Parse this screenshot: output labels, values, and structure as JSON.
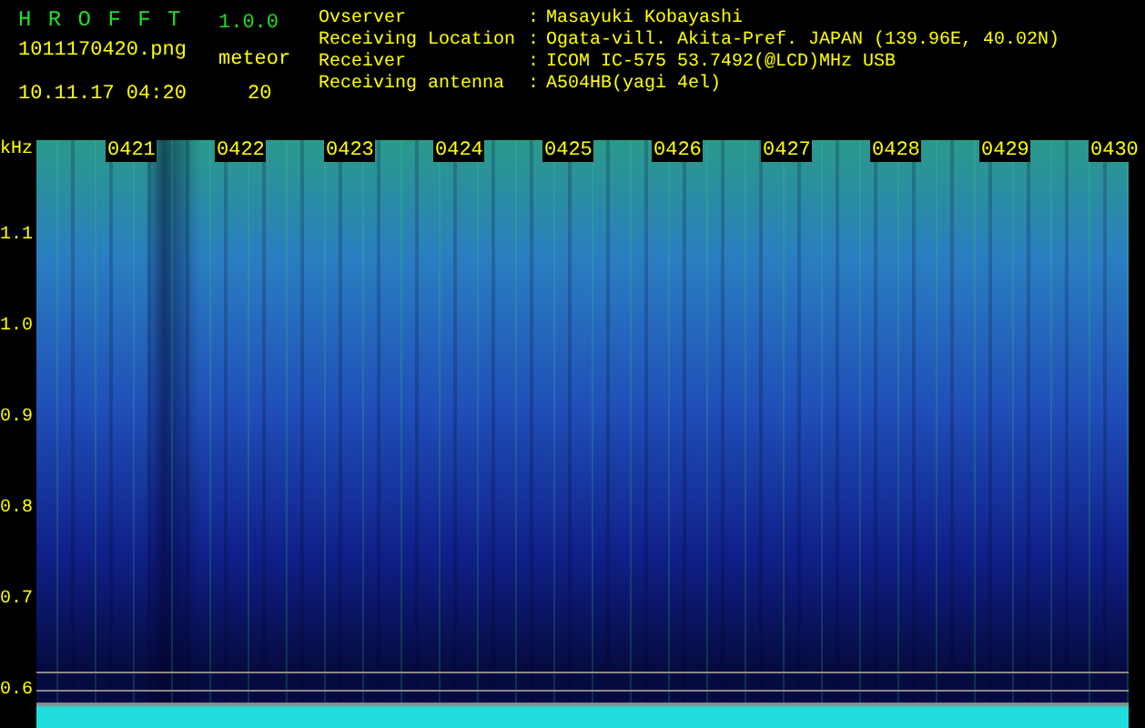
{
  "app": {
    "title": "H R O F F T",
    "version": "1.0.0",
    "file": "1011170420.png",
    "datetime": "10.11.17 04:20",
    "meteor_label": "meteor",
    "meteor_count": "20"
  },
  "info": [
    {
      "label": "Ovserver",
      "separator": ":",
      "value": "Masayuki Kobayashi"
    },
    {
      "label": "Receiving Location",
      "separator": ":",
      "value": "Ogata-vill. Akita-Pref. JAPAN (139.96E, 40.02N)"
    },
    {
      "label": "Receiver",
      "separator": ":",
      "value": "ICOM IC-575 53.7492(@LCD)MHz USB"
    },
    {
      "label": "Receiving antenna",
      "separator": ":",
      "value": "A504HB(yagi 4el)"
    }
  ],
  "spectrogram": {
    "unit": "kHz",
    "time_labels": [
      "0421",
      "0422",
      "0423",
      "0424",
      "0425",
      "0426",
      "0427",
      "0428",
      "0429",
      "0430"
    ],
    "freq_labels": [
      "1.1",
      "1.0",
      "0.9",
      "0.8",
      "0.7",
      "0.6"
    ]
  }
}
